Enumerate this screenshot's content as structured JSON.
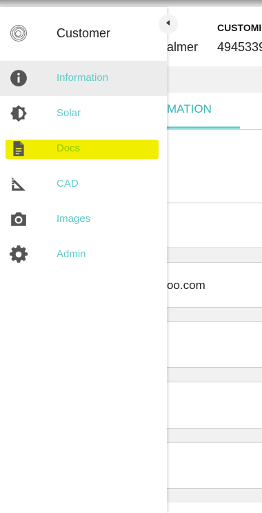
{
  "drawer": {
    "title": "Customer",
    "items": [
      {
        "label": "Information",
        "icon": "info-icon",
        "active": true
      },
      {
        "label": "Solar",
        "icon": "solar-brightness-icon"
      },
      {
        "label": "Docs",
        "icon": "document-icon",
        "highlighted": true
      },
      {
        "label": "CAD",
        "icon": "ruler-triangle-icon"
      },
      {
        "label": "Images",
        "icon": "camera-icon"
      },
      {
        "label": "Admin",
        "icon": "gear-icon"
      }
    ]
  },
  "background": {
    "customer_name_partial": "almer",
    "column_header_partial": "CUSTOMI",
    "customer_number_partial": "4945339",
    "tab_partial": "MATION",
    "email_partial": "oo.com"
  },
  "colors": {
    "accent": "#5ccbc9",
    "active_bg": "#ececec",
    "highlight": "#f2ee00",
    "docs_label": "#8ac800",
    "icon": "#555555"
  }
}
